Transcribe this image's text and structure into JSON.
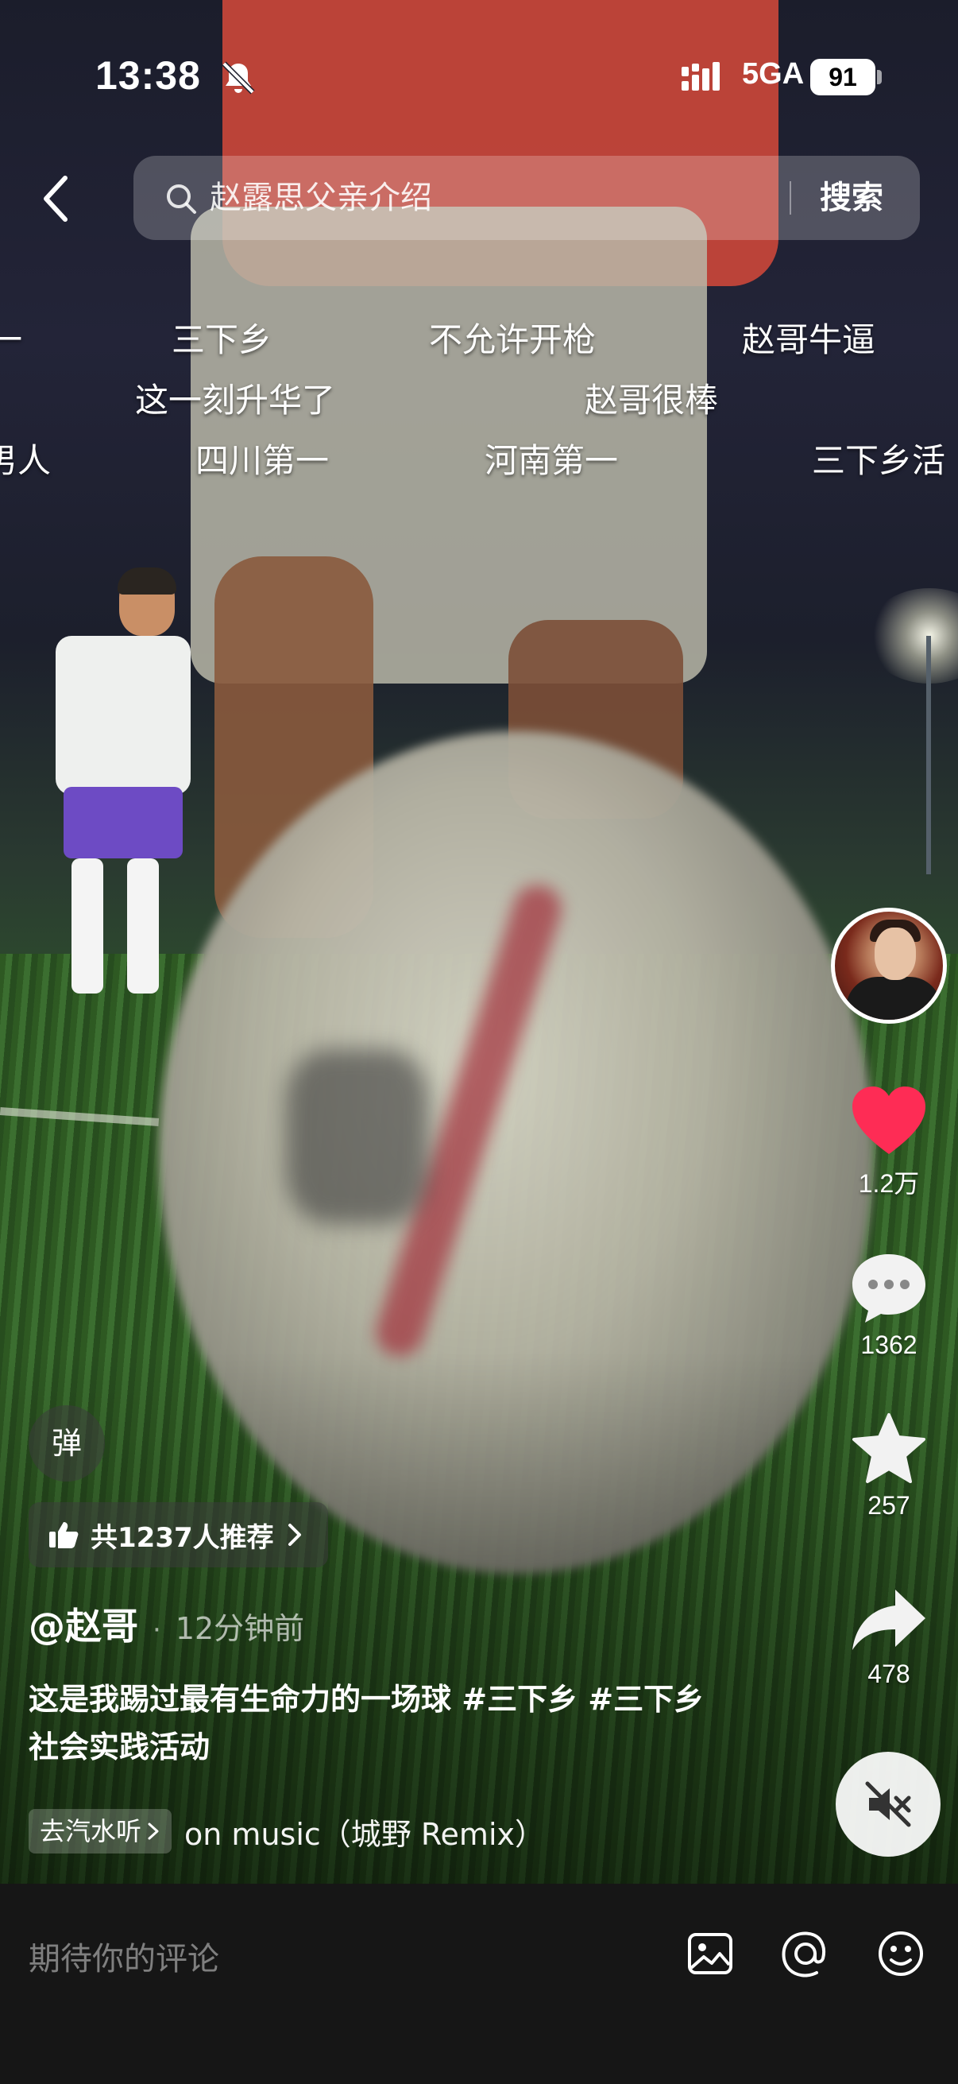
{
  "status_bar": {
    "time": "13:38",
    "network": "5GA",
    "battery": "91"
  },
  "search": {
    "query": "赵露思父亲介绍",
    "button": "搜索"
  },
  "danmaku": [
    {
      "text": "一"
    },
    {
      "text": "三下乡"
    },
    {
      "text": "不允许开枪"
    },
    {
      "text": "赵哥牛逼"
    },
    {
      "text": "这一刻升华了"
    },
    {
      "text": "赵哥很棒"
    },
    {
      "text": "男人"
    },
    {
      "text": "四川第一"
    },
    {
      "text": "河南第一"
    },
    {
      "text": "三下乡活"
    }
  ],
  "actions": {
    "likes": "1.2万",
    "comments": "1362",
    "favorites": "257",
    "shares": "478"
  },
  "overlay": {
    "danmu_toggle": "弹",
    "recommend": "共1237人推荐",
    "author": "@赵哥",
    "separator": "·",
    "time_ago": "12分钟前",
    "caption": "这是我踢过最有生命力的一场球 #三下乡 #三下乡社会实践活动",
    "music_chip": "去汽水听",
    "music_name": "on music（城野 Remix）"
  },
  "comment_bar": {
    "placeholder": "期待你的评论"
  },
  "colors": {
    "like_red": "#fe2c55",
    "bg_dark": "#161616"
  },
  "icons": [
    "back-icon",
    "search-icon",
    "heart-icon",
    "comment-icon",
    "star-icon",
    "share-icon",
    "mute-icon",
    "image-icon",
    "at-icon",
    "emoji-icon",
    "thumbs-up-icon",
    "chevron-right-icon",
    "bell-off-icon",
    "signal-icon",
    "battery-icon"
  ]
}
